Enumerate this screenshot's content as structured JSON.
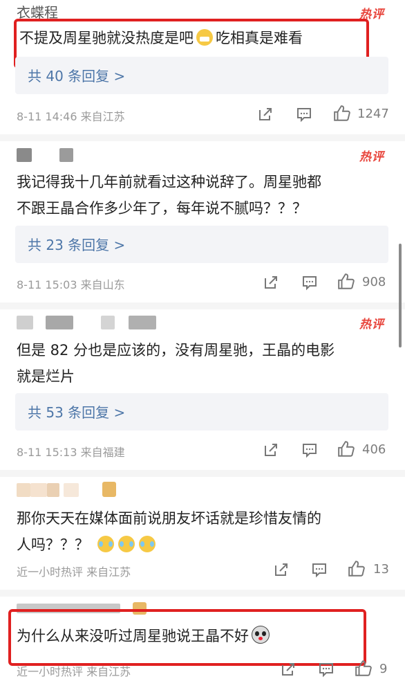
{
  "hot_label": "热评",
  "comments": [
    {
      "username": "衣蝶程_",
      "content": "不提及周星驰就没热度是吧",
      "content_suffix": "吃相真是难看",
      "replies": "共 40 条回复 >",
      "meta": "8-11 14:46  来自江苏",
      "likes": "1247"
    },
    {
      "content_line1": "我记得我十几年前就看过这种说辞了。周星驰都",
      "content_line2": "不跟王晶合作多少年了，每年说不腻吗？？？",
      "replies": "共 23 条回复 >",
      "meta": "8-11 15:03  来自山东",
      "likes": "908"
    },
    {
      "content_line1": "但是 82 分也是应该的，没有周星驰，王晶的电影",
      "content_line2": "就是烂片",
      "replies": "共 53 条回复 >",
      "meta": "8-11 15:13  来自福建",
      "likes": "406"
    },
    {
      "content_line1": "那你天天在媒体面前说朋友坏话就是珍惜友情的",
      "content_line2": "人吗？？？",
      "meta": "近一小时热评  来自江苏",
      "likes": "13"
    },
    {
      "content": "为什么从来没听过周星驰说王晶不好",
      "meta": "近一小时热评  来自江苏",
      "likes": "9"
    }
  ],
  "colors": {
    "hot": "#e8453c",
    "reply_link": "#4d76a8",
    "highlight": "#e02020",
    "meta": "#9a9a9a"
  },
  "icons": [
    "share-icon",
    "comment-icon",
    "like-icon",
    "crying-face-icon",
    "laughing-crying-icon"
  ]
}
